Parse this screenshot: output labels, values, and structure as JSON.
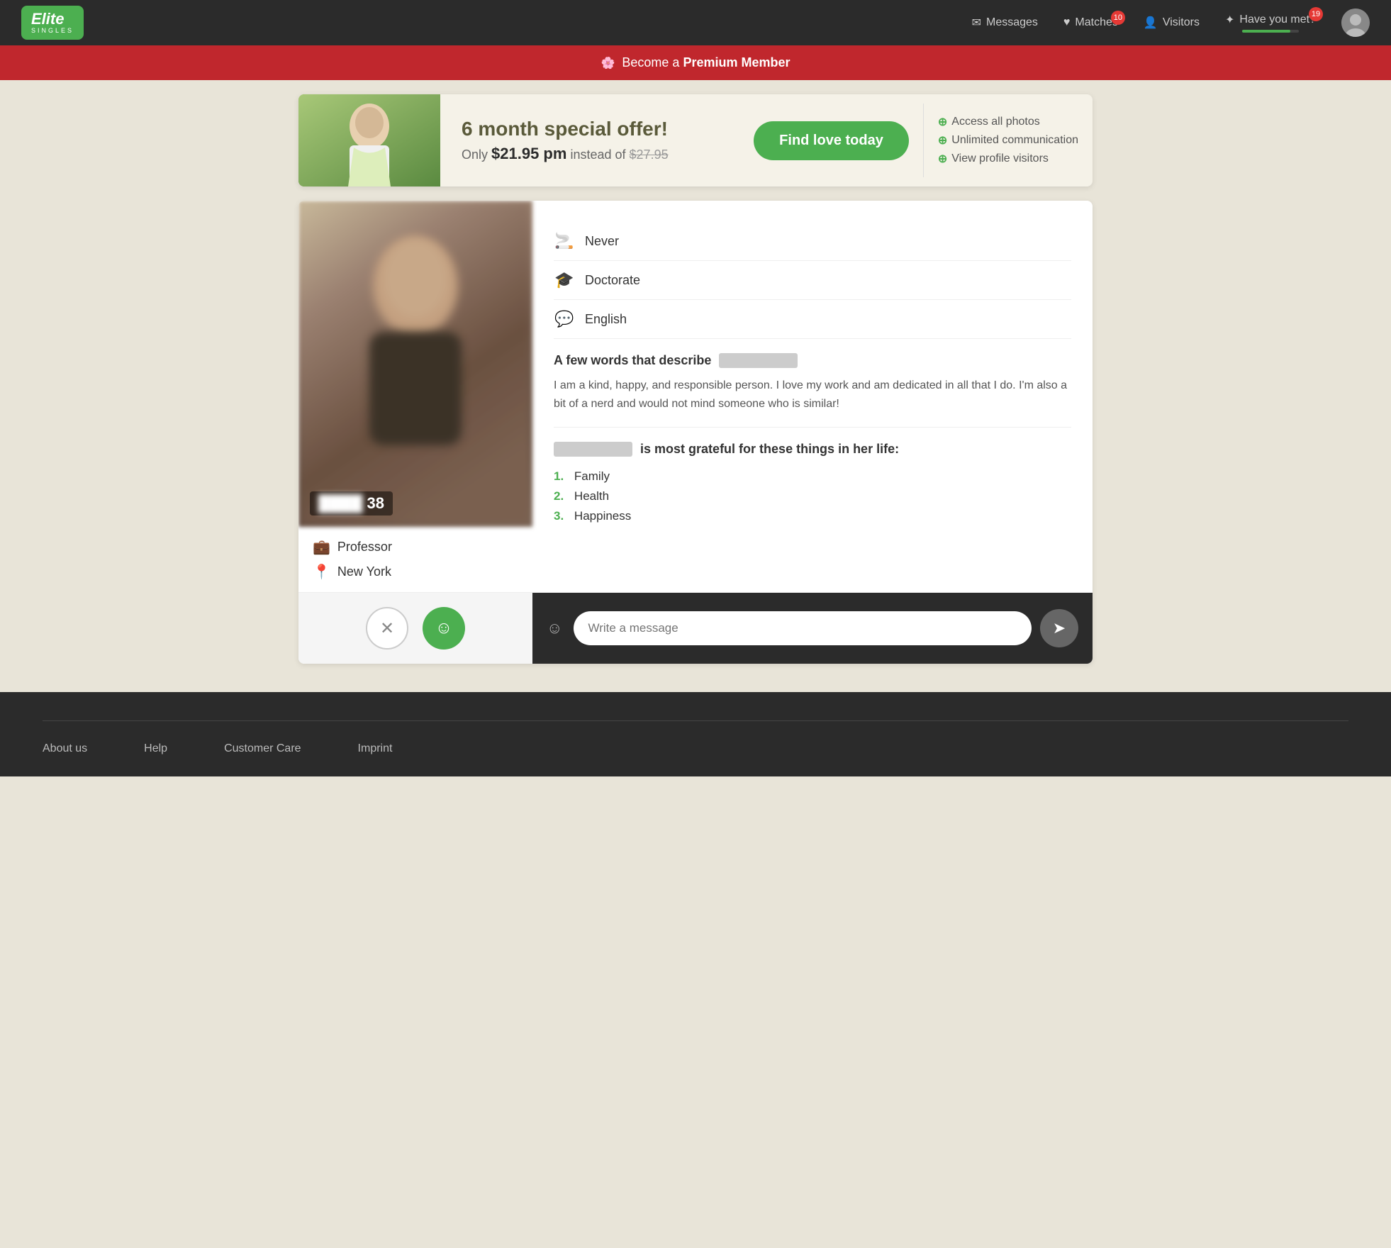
{
  "header": {
    "logo_name": "Elite",
    "logo_sub": "SINGLES",
    "nav_items": [
      {
        "label": "Messages",
        "icon": "✉",
        "badge": null
      },
      {
        "label": "Matches",
        "icon": "♥",
        "badge": "10"
      },
      {
        "label": "Visitors",
        "icon": "👤",
        "badge": null
      },
      {
        "label": "Have you met?",
        "icon": "✦",
        "badge": "19"
      }
    ]
  },
  "premium_bar": {
    "text_normal": "Become a",
    "text_bold": "Premium Member",
    "icon": "🌸"
  },
  "promo": {
    "title": "6 month special offer!",
    "price_label": "Only",
    "price_main": "$21.95 pm",
    "price_instead": "instead of",
    "price_old": "$27.95",
    "cta_label": "Find love today",
    "features": [
      "Access all photos",
      "Unlimited communication",
      "View profile visitors"
    ]
  },
  "profile": {
    "age": "38",
    "attributes": [
      {
        "icon": "🚬",
        "label": "Never"
      },
      {
        "icon": "🎓",
        "label": "Doctorate"
      },
      {
        "icon": "💬",
        "label": "English"
      }
    ],
    "describe_heading": "A few words that describe",
    "describe_text": "I am a kind, happy, and responsible person. I love my work and am dedicated in all that I do. I'm also a bit of a nerd and would not mind someone who is similar!",
    "grateful_heading_suffix": "is most grateful for these things in her life:",
    "grateful_items": [
      {
        "num": "1.",
        "text": "Family"
      },
      {
        "num": "2.",
        "text": "Health"
      },
      {
        "num": "3.",
        "text": "Happiness"
      }
    ],
    "occupation": "Professor",
    "location": "New York",
    "message_placeholder": "Write a message"
  },
  "footer": {
    "links": [
      {
        "label": "About us"
      },
      {
        "label": "Help"
      },
      {
        "label": "Customer Care"
      },
      {
        "label": "Imprint"
      }
    ]
  }
}
